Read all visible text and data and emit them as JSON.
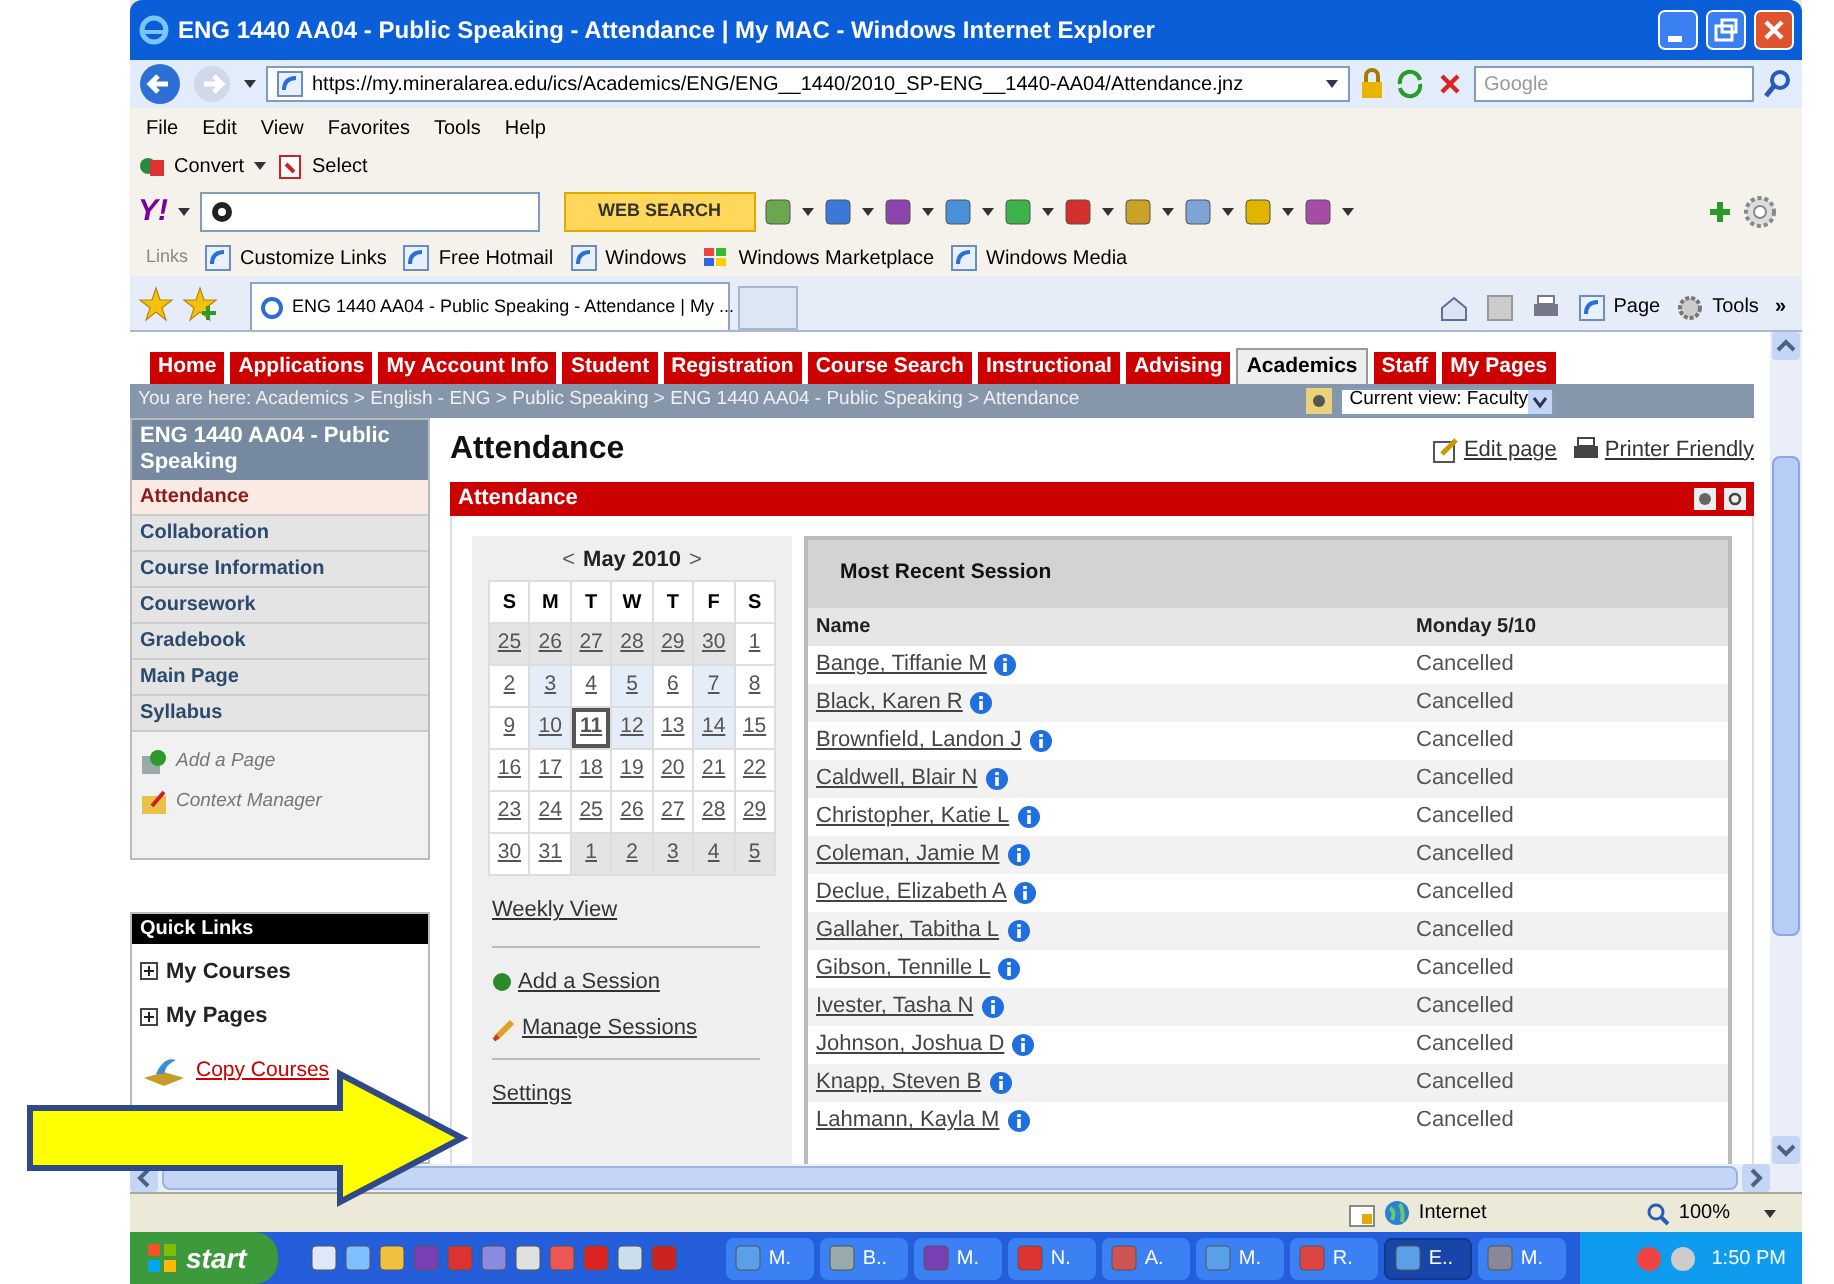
{
  "window": {
    "title": "ENG 1440 AA04 - Public Speaking - Attendance | My MAC - Windows Internet Explorer"
  },
  "address_bar": {
    "url": "https://my.mineralarea.edu/ics/Academics/ENG/ENG__1440/2010_SP-ENG__1440-AA04/Attendance.jnz"
  },
  "search_box": {
    "placeholder": "Google"
  },
  "menu": [
    "File",
    "Edit",
    "View",
    "Favorites",
    "Tools",
    "Help"
  ],
  "convert_bar": [
    "Convert",
    "Select"
  ],
  "yahoo_toolbar": {
    "logo": "Y!",
    "button": "WEB SEARCH"
  },
  "links_bar": {
    "label": "Links",
    "items": [
      "Customize Links",
      "Free Hotmail",
      "Windows",
      "Windows Marketplace",
      "Windows Media"
    ]
  },
  "tabs": [
    {
      "label": "ENG 1440 AA04 - Public Speaking - Attendance | My ...",
      "selected": true
    }
  ],
  "command_bar": [
    "Page",
    "Tools",
    "»"
  ],
  "site_nav": [
    {
      "label": "Home",
      "selected": false
    },
    {
      "label": "Applications",
      "selected": false
    },
    {
      "label": "My Account Info",
      "selected": false
    },
    {
      "label": "Student",
      "selected": false
    },
    {
      "label": "Registration",
      "selected": false
    },
    {
      "label": "Course Search",
      "selected": false
    },
    {
      "label": "Instructional",
      "selected": false
    },
    {
      "label": "Advising",
      "selected": false
    },
    {
      "label": "Academics",
      "selected": true
    },
    {
      "label": "Staff",
      "selected": false
    },
    {
      "label": "My Pages",
      "selected": false
    }
  ],
  "breadcrumb": "You are here:  Academics > English - ENG > Public Speaking > ENG 1440 AA04 - Public Speaking > Attendance",
  "view_select": "Current view: Faculty",
  "sidebar": {
    "title": "ENG 1440 AA04 - Public Speaking",
    "items": [
      {
        "label": "Attendance",
        "selected": true
      },
      {
        "label": "Collaboration",
        "selected": false
      },
      {
        "label": "Course Information",
        "selected": false
      },
      {
        "label": "Coursework",
        "selected": false
      },
      {
        "label": "Gradebook",
        "selected": false
      },
      {
        "label": "Main Page",
        "selected": false
      },
      {
        "label": "Syllabus",
        "selected": false
      }
    ],
    "tools": [
      "Add a Page",
      "Context Manager"
    ]
  },
  "quick_links": {
    "title": "Quick Links",
    "items": [
      {
        "label": "My Courses",
        "kind": "expand"
      },
      {
        "label": "My Pages",
        "kind": "expand"
      },
      {
        "label": "Copy Courses",
        "kind": "link"
      }
    ]
  },
  "page_title": "Attendance",
  "page_actions": [
    "Edit page",
    "Printer Friendly"
  ],
  "portlet_title": "Attendance",
  "calendar": {
    "prev": "<",
    "title": "May 2010",
    "next": ">",
    "weekdays": [
      "S",
      "M",
      "T",
      "W",
      "T",
      "F",
      "S"
    ],
    "weeks": [
      [
        {
          "day": "25",
          "kind": "outside"
        },
        {
          "day": "26",
          "kind": "outside"
        },
        {
          "day": "27",
          "kind": "outside"
        },
        {
          "day": "28",
          "kind": "outside"
        },
        {
          "day": "29",
          "kind": "outside"
        },
        {
          "day": "30",
          "kind": "outside"
        },
        {
          "day": "1",
          "kind": "normal"
        }
      ],
      [
        {
          "day": "2",
          "kind": "normal"
        },
        {
          "day": "3",
          "kind": "session"
        },
        {
          "day": "4",
          "kind": "normal"
        },
        {
          "day": "5",
          "kind": "session"
        },
        {
          "day": "6",
          "kind": "normal"
        },
        {
          "day": "7",
          "kind": "session"
        },
        {
          "day": "8",
          "kind": "normal"
        }
      ],
      [
        {
          "day": "9",
          "kind": "normal"
        },
        {
          "day": "10",
          "kind": "session"
        },
        {
          "day": "11",
          "kind": "today"
        },
        {
          "day": "12",
          "kind": "session"
        },
        {
          "day": "13",
          "kind": "normal"
        },
        {
          "day": "14",
          "kind": "session"
        },
        {
          "day": "15",
          "kind": "normal"
        }
      ],
      [
        {
          "day": "16",
          "kind": "normal"
        },
        {
          "day": "17",
          "kind": "normal"
        },
        {
          "day": "18",
          "kind": "normal"
        },
        {
          "day": "19",
          "kind": "normal"
        },
        {
          "day": "20",
          "kind": "normal"
        },
        {
          "day": "21",
          "kind": "normal"
        },
        {
          "day": "22",
          "kind": "normal"
        }
      ],
      [
        {
          "day": "23",
          "kind": "normal"
        },
        {
          "day": "24",
          "kind": "normal"
        },
        {
          "day": "25",
          "kind": "normal"
        },
        {
          "day": "26",
          "kind": "normal"
        },
        {
          "day": "27",
          "kind": "normal"
        },
        {
          "day": "28",
          "kind": "normal"
        },
        {
          "day": "29",
          "kind": "normal"
        }
      ],
      [
        {
          "day": "30",
          "kind": "normal"
        },
        {
          "day": "31",
          "kind": "normal"
        },
        {
          "day": "1",
          "kind": "outside"
        },
        {
          "day": "2",
          "kind": "outside"
        },
        {
          "day": "3",
          "kind": "outside"
        },
        {
          "day": "4",
          "kind": "outside"
        },
        {
          "day": "5",
          "kind": "outside"
        }
      ]
    ]
  },
  "calendar_links": [
    {
      "label": "Weekly View",
      "kind": "plain"
    },
    {
      "label": "Add a Session",
      "kind": "add"
    },
    {
      "label": "Manage Sessions",
      "kind": "edit"
    },
    {
      "label": "Settings",
      "kind": "plain"
    }
  ],
  "session": {
    "title": "Most Recent Session",
    "columns": [
      "Name",
      "Monday 5/10"
    ],
    "rows": [
      {
        "name": "Bange, Tiffanie M",
        "status": "Cancelled"
      },
      {
        "name": "Black, Karen R",
        "status": "Cancelled"
      },
      {
        "name": "Brownfield, Landon J",
        "status": "Cancelled"
      },
      {
        "name": "Caldwell, Blair N",
        "status": "Cancelled"
      },
      {
        "name": "Christopher, Katie L",
        "status": "Cancelled"
      },
      {
        "name": "Coleman, Jamie M",
        "status": "Cancelled"
      },
      {
        "name": "Declue, Elizabeth A",
        "status": "Cancelled"
      },
      {
        "name": "Gallaher, Tabitha L",
        "status": "Cancelled"
      },
      {
        "name": "Gibson, Tennille L",
        "status": "Cancelled"
      },
      {
        "name": "Ivester, Tasha N",
        "status": "Cancelled"
      },
      {
        "name": "Johnson, Joshua D",
        "status": "Cancelled"
      },
      {
        "name": "Knapp, Steven B",
        "status": "Cancelled"
      },
      {
        "name": "Lahmann, Kayla M",
        "status": "Cancelled"
      }
    ]
  },
  "status_bar": {
    "zone": "Internet",
    "zoom": "100%"
  },
  "taskbar": {
    "start": "start",
    "buttons": [
      {
        "label": "M.",
        "selected": false
      },
      {
        "label": "B..",
        "selected": false
      },
      {
        "label": "M.",
        "selected": false
      },
      {
        "label": "N.",
        "selected": false
      },
      {
        "label": "A.",
        "selected": false
      },
      {
        "label": "M.",
        "selected": false
      },
      {
        "label": "R.",
        "selected": false
      },
      {
        "label": "E..",
        "selected": true
      },
      {
        "label": "M.",
        "selected": false
      }
    ],
    "clock": "1:50 PM"
  }
}
